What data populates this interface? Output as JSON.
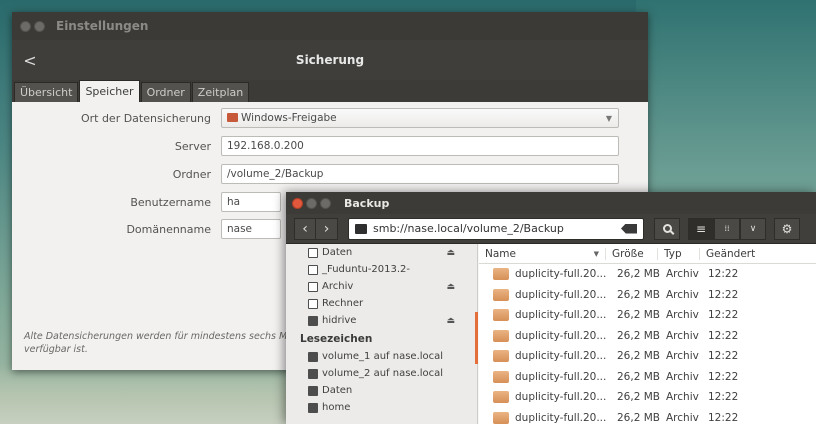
{
  "settings": {
    "window_title": "Einstellungen",
    "header_title": "Sicherung",
    "back_label": "<",
    "tabs": [
      {
        "label": "Übersicht"
      },
      {
        "label": "Speicher"
      },
      {
        "label": "Ordner"
      },
      {
        "label": "Zeitplan"
      }
    ],
    "active_tab": "Speicher",
    "location_label": "Ort der Datensicherung",
    "location_value": "Windows-Freigabe",
    "server_label": "Server",
    "server_value": "192.168.0.200",
    "folder_label": "Ordner",
    "folder_value": "/volume_2/Backup",
    "username_label": "Benutzername",
    "username_value": "ha",
    "domain_label": "Domänenname",
    "domain_value": "nase",
    "note": "Alte Datensicherungen werden für mindestens sechs M verfügbar ist."
  },
  "filemanager": {
    "window_title": "Backup",
    "location_path": "smb://nase.local/volume_2/Backup",
    "sidebar": {
      "devices": [
        {
          "label": "Daten",
          "icon": "drive-icon",
          "eject": true
        },
        {
          "label": "_Fuduntu-2013.2-",
          "icon": "drive-icon",
          "eject": false
        },
        {
          "label": "Archiv",
          "icon": "drive-icon",
          "eject": true
        },
        {
          "label": "Rechner",
          "icon": "drive-icon",
          "eject": false
        },
        {
          "label": "hidrive",
          "icon": "network-drive-icon",
          "eject": true
        }
      ],
      "bookmarks_heading": "Lesezeichen",
      "bookmarks": [
        {
          "label": "volume_1 auf nase.local"
        },
        {
          "label": "volume_2 auf nase.local"
        },
        {
          "label": "Daten"
        },
        {
          "label": "home"
        }
      ]
    },
    "columns": {
      "name": "Name",
      "size": "Größe",
      "type": "Typ",
      "modified": "Geändert"
    },
    "files": [
      {
        "name": "duplicity-full.20...",
        "size": "26,2 MB",
        "type": "Archiv",
        "modified": "12:22"
      },
      {
        "name": "duplicity-full.20...",
        "size": "26,2 MB",
        "type": "Archiv",
        "modified": "12:22"
      },
      {
        "name": "duplicity-full.20...",
        "size": "26,2 MB",
        "type": "Archiv",
        "modified": "12:22"
      },
      {
        "name": "duplicity-full.20...",
        "size": "26,2 MB",
        "type": "Archiv",
        "modified": "12:22"
      },
      {
        "name": "duplicity-full.20...",
        "size": "26,2 MB",
        "type": "Archiv",
        "modified": "12:22"
      },
      {
        "name": "duplicity-full.20...",
        "size": "26,2 MB",
        "type": "Archiv",
        "modified": "12:22"
      },
      {
        "name": "duplicity-full.20...",
        "size": "26,2 MB",
        "type": "Archiv",
        "modified": "12:22"
      },
      {
        "name": "duplicity-full.20...",
        "size": "26,2 MB",
        "type": "Archiv",
        "modified": "12:22"
      }
    ],
    "colors": {
      "accent": "#e46e3a",
      "titlebar": "#3c3b37"
    }
  }
}
